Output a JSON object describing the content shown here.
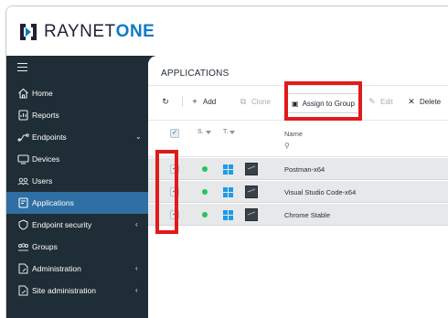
{
  "brand": {
    "name_part1": "RAYNET",
    "name_part2": "ONE",
    "accent_color": "#0d7ac7"
  },
  "sidebar": {
    "menu_icon": "hamburger-icon",
    "items": [
      {
        "label": "Home",
        "icon": "home-icon",
        "chevron": ""
      },
      {
        "label": "Reports",
        "icon": "report-icon",
        "chevron": ""
      },
      {
        "label": "Endpoints",
        "icon": "endpoints-icon",
        "chevron": "⌄"
      },
      {
        "label": "Devices",
        "icon": "device-icon",
        "chevron": ""
      },
      {
        "label": "Users",
        "icon": "users-icon",
        "chevron": ""
      },
      {
        "label": "Applications",
        "icon": "applications-icon",
        "chevron": "",
        "active": true
      },
      {
        "label": "Endpoint security",
        "icon": "shield-icon",
        "chevron": "‹"
      },
      {
        "label": "Groups",
        "icon": "groups-icon",
        "chevron": ""
      },
      {
        "label": "Administration",
        "icon": "admin-icon",
        "chevron": "‹"
      },
      {
        "label": "Site administration",
        "icon": "site-admin-icon",
        "chevron": "‹"
      }
    ],
    "active_color": "#2f6fa3",
    "background_color": "#1f2d36"
  },
  "main": {
    "title": "APPLICATIONS",
    "toolbar": {
      "refresh_icon": "refresh-icon",
      "add_label": "Add",
      "clone_label": "Clone",
      "assign_label": "Assign to Group",
      "edit_label": "Edit",
      "delete_label": "Delete"
    },
    "grid": {
      "col_status": "S.",
      "col_type": "T.",
      "col_name": "Name",
      "rows": [
        {
          "name": "Postman-x64",
          "checked": true,
          "status": "online"
        },
        {
          "name": "Visual Studio Code-x64",
          "checked": true,
          "status": "online"
        },
        {
          "name": "Chrome Stable",
          "checked": true,
          "status": "online"
        }
      ]
    }
  },
  "highlight_color": "#e11a1a"
}
